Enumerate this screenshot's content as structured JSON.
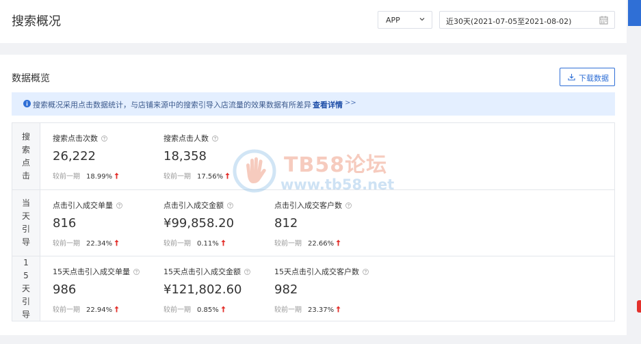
{
  "header": {
    "title": "搜索概况",
    "platform": "APP",
    "date_range": "近30天(2021-07-05至2021-08-02)"
  },
  "overview": {
    "title": "数据概览",
    "download_label": "下载数据",
    "notice": {
      "text": "搜索概况采用点击数据统计，与店铺来源中的搜索引导入店流量的效果数据有所差异",
      "link": "查看详情",
      "arrows": ">>"
    },
    "compare_label": "较前一期",
    "groups": [
      {
        "label": "搜索点击",
        "metrics": [
          {
            "title": "搜索点击次数",
            "value": "26,222",
            "change": "18.99%",
            "trend": "up"
          },
          {
            "title": "搜索点击人数",
            "value": "18,358",
            "change": "17.56%",
            "trend": "up"
          }
        ]
      },
      {
        "label": "当天引导",
        "metrics": [
          {
            "title": "点击引入成交单量",
            "value": "816",
            "change": "22.34%",
            "trend": "up"
          },
          {
            "title": "点击引入成交金额",
            "value": "¥99,858.20",
            "change": "0.11%",
            "trend": "up"
          },
          {
            "title": "点击引入成交客户数",
            "value": "812",
            "change": "22.66%",
            "trend": "up"
          }
        ]
      },
      {
        "label": "15天引导",
        "metrics": [
          {
            "title": "15天点击引入成交单量",
            "value": "986",
            "change": "22.94%",
            "trend": "up"
          },
          {
            "title": "15天点击引入成交金额",
            "value": "¥121,802.60",
            "change": "0.85%",
            "trend": "up"
          },
          {
            "title": "15天点击引入成交客户数",
            "value": "982",
            "change": "23.37%",
            "trend": "up"
          }
        ]
      }
    ]
  },
  "watermark": {
    "name": "TB58论坛",
    "url": "www.tb58.net"
  },
  "colors": {
    "accent": "#2f6fd6",
    "up_arrow": "#e3312c",
    "notice_bg": "#e4efff"
  }
}
